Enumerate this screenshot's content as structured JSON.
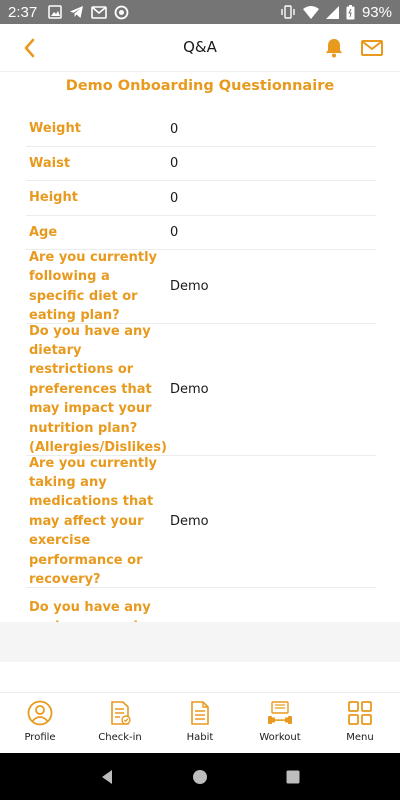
{
  "status_bar": {
    "time": "2:37",
    "battery": "93%"
  },
  "header": {
    "title": "Q&A"
  },
  "questionnaire": {
    "title": "Demo Onboarding Questionnaire",
    "rows": [
      {
        "label": "Weight",
        "value": "0"
      },
      {
        "label": "Waist",
        "value": "0"
      },
      {
        "label": "Height",
        "value": "0"
      },
      {
        "label": "Age",
        "value": "0"
      },
      {
        "label": "Are you currently following a specific diet or eating plan?",
        "value": "Demo"
      },
      {
        "label": "Do you have any dietary restrictions or preferences that may impact your nutrition plan? (Allergies/Dislikes)",
        "value": "Demo"
      },
      {
        "label": "Are you currently taking any medications that may affect your exercise performance or recovery?",
        "value": "Demo"
      },
      {
        "label": "Do you have any past or current injuries or",
        "value": ""
      }
    ]
  },
  "bottom_nav": {
    "items": [
      {
        "label": "Profile",
        "icon": "profile-icon"
      },
      {
        "label": "Check-in",
        "icon": "checkin-icon"
      },
      {
        "label": "Habit",
        "icon": "habit-icon"
      },
      {
        "label": "Workout",
        "icon": "workout-icon"
      },
      {
        "label": "Menu",
        "icon": "menu-grid-icon"
      }
    ]
  },
  "colors": {
    "accent": "#e89a1f",
    "status_bar": "#757575",
    "text": "#1a1a1a"
  }
}
